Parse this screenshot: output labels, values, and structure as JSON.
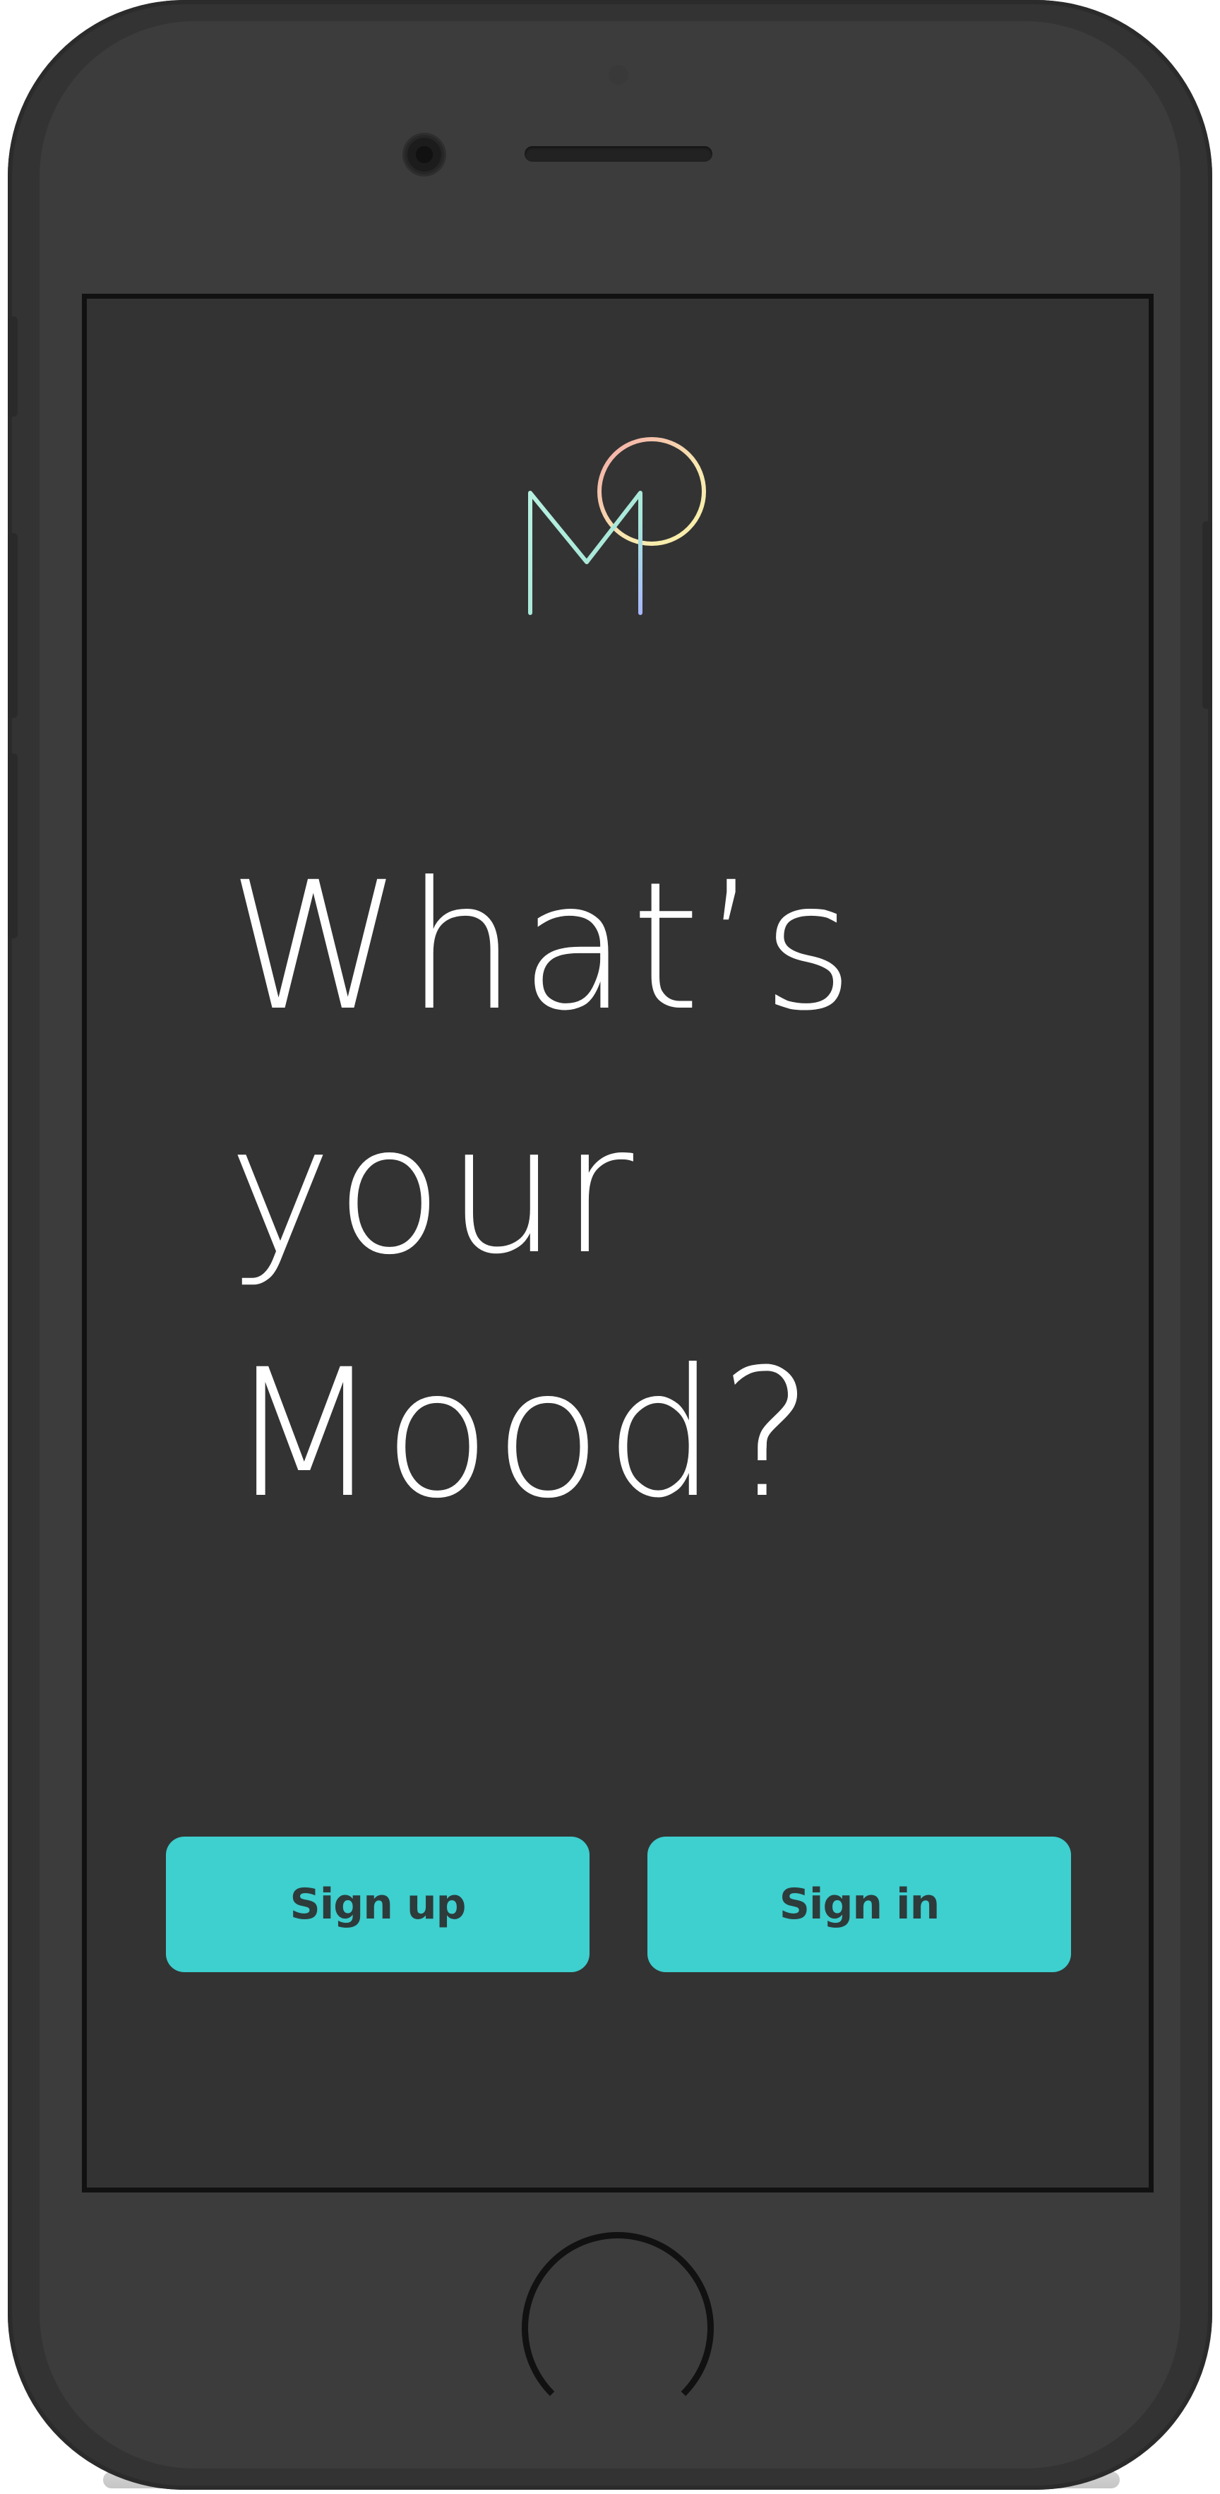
{
  "app": {
    "headline_lines": [
      "What’s",
      "your",
      "Mood?"
    ]
  },
  "actions": {
    "signup_label": "Sign up",
    "signin_label": "Sign in"
  },
  "colors": {
    "screen_background": "#333333",
    "device_body": "#3c3c3c",
    "accent": "#3ecfcf",
    "button_text": "#2d3b3b",
    "headline_text": "#ffffff",
    "logo_gradient": [
      "#b8f0e0",
      "#a8b8ff",
      "#f4a8a8",
      "#f8f0a8"
    ]
  },
  "icons": {
    "logo": "mood-logo-icon",
    "camera": "front-camera-icon",
    "speaker": "earpiece-speaker-icon",
    "home": "home-button-icon"
  }
}
